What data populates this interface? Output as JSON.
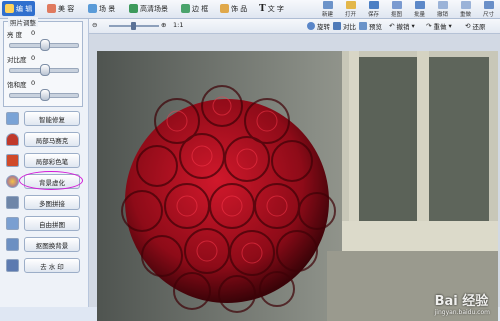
{
  "tabs": [
    {
      "label": "编 辑",
      "active": true,
      "color": "#3a78d8"
    },
    {
      "label": "美 容",
      "active": false,
      "color": "#e07a5f"
    },
    {
      "label": "场 景",
      "active": false,
      "color": "#5a9bd8"
    },
    {
      "label": "高清场景",
      "active": false,
      "color": "#3d9a5c"
    },
    {
      "label": "边 框",
      "active": false,
      "color": "#4aa36c"
    },
    {
      "label": "饰 品",
      "active": false,
      "color": "#e0a84a"
    },
    {
      "label": "文 字",
      "active": false,
      "color": "#555555"
    }
  ],
  "tools": [
    "新建",
    "打开",
    "保存",
    "抠图",
    "批量",
    "撤销",
    "重做",
    "尺寸"
  ],
  "adjust_panel": {
    "title": "照片调整",
    "sliders": [
      {
        "label": "亮 度",
        "value": "0",
        "level": 0.5
      },
      {
        "label": "对比度",
        "value": "0",
        "level": 0.5
      },
      {
        "label": "饱和度",
        "value": "0",
        "level": 0.5
      }
    ]
  },
  "functions": [
    {
      "label": "智能修复",
      "color": "#7aa3d6"
    },
    {
      "label": "局部马赛克",
      "color": "#c0392b"
    },
    {
      "label": "局部彩色笔",
      "color": "#d04a2a"
    },
    {
      "label": "背景虚化",
      "color": "#8a5bb3",
      "highlighted": true
    },
    {
      "label": "多图拼接",
      "color": "#6f86a8"
    },
    {
      "label": "自由拼图",
      "color": "#7a9fd1"
    },
    {
      "label": "抠图换背景",
      "color": "#6b8fc2"
    },
    {
      "label": "去 水 印",
      "color": "#5c7ab0"
    }
  ],
  "toolbar": {
    "zoom_label": "1:1",
    "items": [
      "旋转",
      "对比",
      "预览",
      "撤销",
      "重做",
      "还原"
    ]
  },
  "watermark": {
    "text": "Bai 经验",
    "sub": "jingyan.baidu.com"
  },
  "colors": {
    "accent": "#2f6fce",
    "highlight_circle": "#d31ad8"
  }
}
